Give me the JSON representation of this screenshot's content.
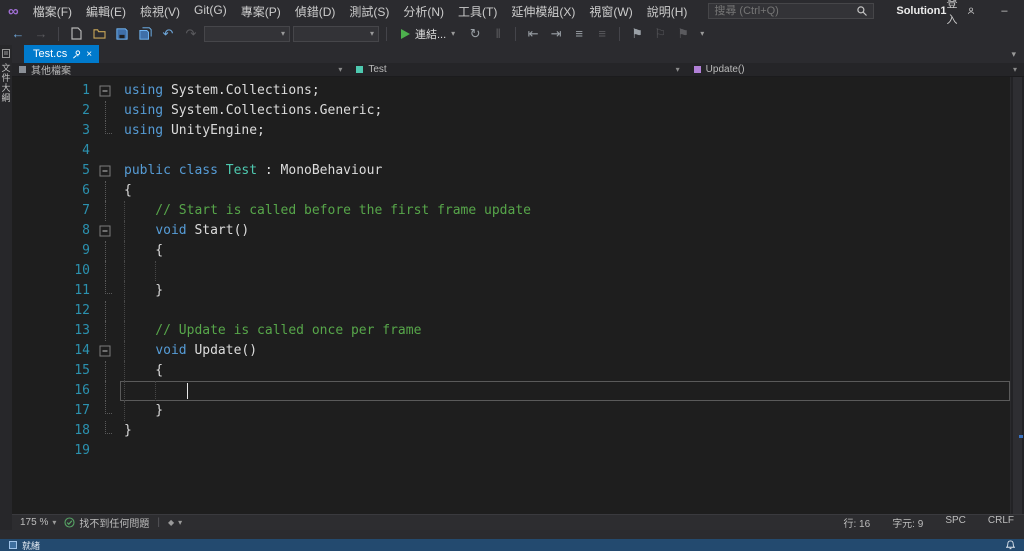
{
  "colors": {
    "accent_blue": "#007acc",
    "run_green": "#4db04d",
    "keyword": "#569cd6",
    "type": "#4ec9b0",
    "comment": "#57a64a",
    "plain_text": "#dcdcdc",
    "line_number": "#2b91af",
    "editor_bg": "#1e1e1e",
    "status_bg": "#234a6f"
  },
  "window": {
    "logo_glyph": "∞",
    "menus": [
      "檔案(F)",
      "編輯(E)",
      "檢視(V)",
      "Git(G)",
      "專案(P)",
      "偵錯(D)",
      "測試(S)",
      "分析(N)",
      "工具(T)",
      "延伸模組(X)",
      "視窗(W)",
      "說明(H)"
    ],
    "search_placeholder": "搜尋 (Ctrl+Q)",
    "solution_name": "Solution1",
    "signin_label": "登入",
    "minimize_glyph": "–",
    "maximize_glyph": "□",
    "close_glyph": "×"
  },
  "toolbar": {
    "attach_label": "連結...",
    "icons": {
      "back": "←",
      "forward": "→",
      "undo": "↶",
      "redo": "↷",
      "caret": "▾",
      "hot_reload": "↻",
      "pause": "‖",
      "indent_decrease": "⇤",
      "indent_increase": "⇥",
      "comment": "≡",
      "uncomment": "≡",
      "bookmark_toggle": "⚑",
      "bookmark_prev": "⚐",
      "bookmark_next": "⚑",
      "overflow": "▾"
    }
  },
  "panel": {
    "document_outline_label": "文件大綱"
  },
  "tab": {
    "title": "Test.cs",
    "close_glyph": "×"
  },
  "tabrow": {
    "overflow_glyph": "▾"
  },
  "breadcrumb": {
    "project": "其他檔案",
    "type_name": "Test",
    "member_name": "Update()",
    "caret": "▾"
  },
  "editor": {
    "lines": [
      {
        "n": "1",
        "f": "box",
        "g": [],
        "tk": [
          [
            "kw",
            "using"
          ],
          [
            "pl",
            " System.Collections;"
          ]
        ]
      },
      {
        "n": "2",
        "f": "line",
        "g": [],
        "tk": [
          [
            "kw",
            "using"
          ],
          [
            "pl",
            " System.Collections.Generic;"
          ]
        ]
      },
      {
        "n": "3",
        "f": "end",
        "g": [],
        "tk": [
          [
            "kw",
            "using"
          ],
          [
            "pl",
            " UnityEngine;"
          ]
        ]
      },
      {
        "n": "4",
        "f": "",
        "g": [],
        "tk": []
      },
      {
        "n": "5",
        "f": "box",
        "g": [],
        "tk": [
          [
            "kw",
            "public class "
          ],
          [
            "ty",
            "Test"
          ],
          [
            "pl",
            " : MonoBehaviour"
          ]
        ]
      },
      {
        "n": "6",
        "f": "line",
        "g": [],
        "tk": [
          [
            "pl",
            "{"
          ]
        ]
      },
      {
        "n": "7",
        "f": "line",
        "g": [
          0
        ],
        "tk": [
          [
            "cm",
            "    // Start is called before the first frame update"
          ]
        ]
      },
      {
        "n": "8",
        "f": "box",
        "g": [
          0
        ],
        "tk": [
          [
            "pl",
            "    "
          ],
          [
            "kw",
            "void "
          ],
          [
            "pl",
            "Start()"
          ]
        ]
      },
      {
        "n": "9",
        "f": "line",
        "g": [
          0
        ],
        "tk": [
          [
            "pl",
            "    {"
          ]
        ]
      },
      {
        "n": "10",
        "f": "line",
        "g": [
          0,
          4
        ],
        "tk": []
      },
      {
        "n": "11",
        "f": "end",
        "g": [
          0
        ],
        "tk": [
          [
            "pl",
            "    }"
          ]
        ]
      },
      {
        "n": "12",
        "f": "line",
        "g": [
          0
        ],
        "tk": []
      },
      {
        "n": "13",
        "f": "line",
        "g": [
          0
        ],
        "tk": [
          [
            "cm",
            "    // Update is called once per frame"
          ]
        ]
      },
      {
        "n": "14",
        "f": "box",
        "g": [
          0
        ],
        "tk": [
          [
            "pl",
            "    "
          ],
          [
            "kw",
            "void "
          ],
          [
            "pl",
            "Update()"
          ]
        ]
      },
      {
        "n": "15",
        "f": "line",
        "g": [
          0
        ],
        "tk": [
          [
            "pl",
            "    {"
          ]
        ]
      },
      {
        "n": "16",
        "f": "line",
        "g": [
          0,
          4
        ],
        "cur": true,
        "cursor": 8,
        "tk": []
      },
      {
        "n": "17",
        "f": "end",
        "g": [
          0
        ],
        "tk": [
          [
            "pl",
            "    }"
          ]
        ]
      },
      {
        "n": "18",
        "f": "end",
        "g": [],
        "tk": [
          [
            "pl",
            "}"
          ]
        ]
      },
      {
        "n": "19",
        "f": "",
        "g": [],
        "tk": []
      }
    ]
  },
  "editor_status": {
    "zoom": "175 %",
    "caret": "▾",
    "health_text": "找不到任何問題",
    "filter_glyph": "◆",
    "line_label": "行: 16",
    "column_label": "字元: 9",
    "spaces_label": "SPC",
    "eol_label": "CRLF"
  },
  "statusbar": {
    "ready_label": "就緒"
  }
}
